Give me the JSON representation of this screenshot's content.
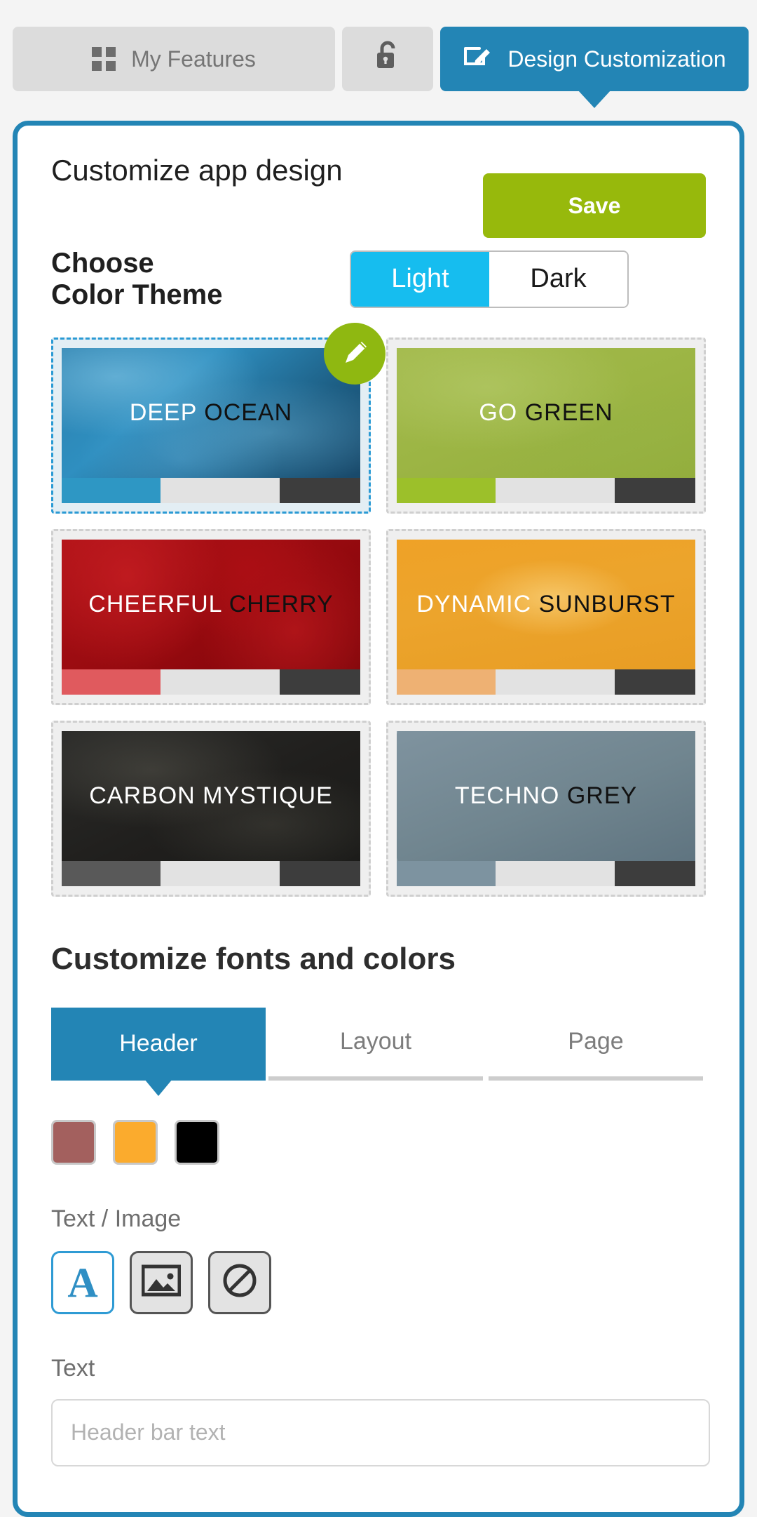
{
  "topbar": {
    "tabs": [
      {
        "label": "My Features",
        "icon": "grid-icon",
        "active": false
      },
      {
        "label": "",
        "icon": "lock-icon",
        "active": false
      },
      {
        "label": "Design Customization",
        "icon": "edit-pencil-icon",
        "active": true
      }
    ]
  },
  "panel": {
    "page_title": "Customize app design",
    "save_label": "Save",
    "accent_color": "#2385b5",
    "save_color": "#97b90c"
  },
  "color_theme": {
    "heading_line1": "Choose",
    "heading_line2": "Color Theme",
    "toggle": {
      "light": "Light",
      "dark": "Dark",
      "selected": "Light",
      "active_color": "#16bdef"
    },
    "themes": [
      {
        "name_first": "DEEP",
        "name_second": "OCEAN",
        "selected": true,
        "editable": true,
        "strip": [
          "#2e97c4",
          "#e2e2e2",
          "#3d3d3d"
        ],
        "texture": "tx-ocean",
        "first_color": "#ffffff",
        "second_color": "#111111"
      },
      {
        "name_first": "GO",
        "name_second": "GREEN",
        "selected": false,
        "editable": false,
        "strip": [
          "#9cc02a",
          "#e2e2e2",
          "#3d3d3d"
        ],
        "texture": "tx-green",
        "first_color": "#ffffff",
        "second_color": "#111111"
      },
      {
        "name_first": "CHEERFUL",
        "name_second": "CHERRY",
        "selected": false,
        "editable": false,
        "strip": [
          "#e05a5e",
          "#e2e2e2",
          "#3d3d3d"
        ],
        "texture": "tx-cherry",
        "first_color": "#ffffff",
        "second_color": "#111111"
      },
      {
        "name_first": "DYNAMIC",
        "name_second": "SUNBURST",
        "selected": false,
        "editable": false,
        "strip": [
          "#eeb173",
          "#e2e2e2",
          "#3d3d3d"
        ],
        "texture": "tx-sun",
        "first_color": "#ffffff",
        "second_color": "#111111"
      },
      {
        "name_first": "CARBON",
        "name_second": "MYSTIQUE",
        "selected": false,
        "editable": false,
        "strip": [
          "#595959",
          "#e2e2e2",
          "#3d3d3d"
        ],
        "texture": "tx-carbon",
        "first_color": "#ffffff",
        "second_color": "#ffffff"
      },
      {
        "name_first": "TECHNO",
        "name_second": "GREY",
        "selected": false,
        "editable": false,
        "strip": [
          "#7d93a0",
          "#e2e2e2",
          "#3d3d3d"
        ],
        "texture": "tx-grey",
        "first_color": "#ffffff",
        "second_color": "#111111"
      }
    ]
  },
  "fonts_colors": {
    "title": "Customize fonts and colors",
    "tabs": [
      {
        "label": "Header",
        "active": true
      },
      {
        "label": "Layout",
        "active": false
      },
      {
        "label": "Page",
        "active": false
      }
    ],
    "swatches": [
      "#a3605e",
      "#fbab2d",
      "#000000"
    ],
    "text_image_label": "Text / Image",
    "mode_buttons": [
      {
        "icon": "letter-a-icon",
        "active": true
      },
      {
        "icon": "image-icon",
        "active": false
      },
      {
        "icon": "no-entry-icon",
        "active": false
      }
    ],
    "text_label": "Text",
    "text_placeholder": "Header bar text",
    "text_value": ""
  }
}
